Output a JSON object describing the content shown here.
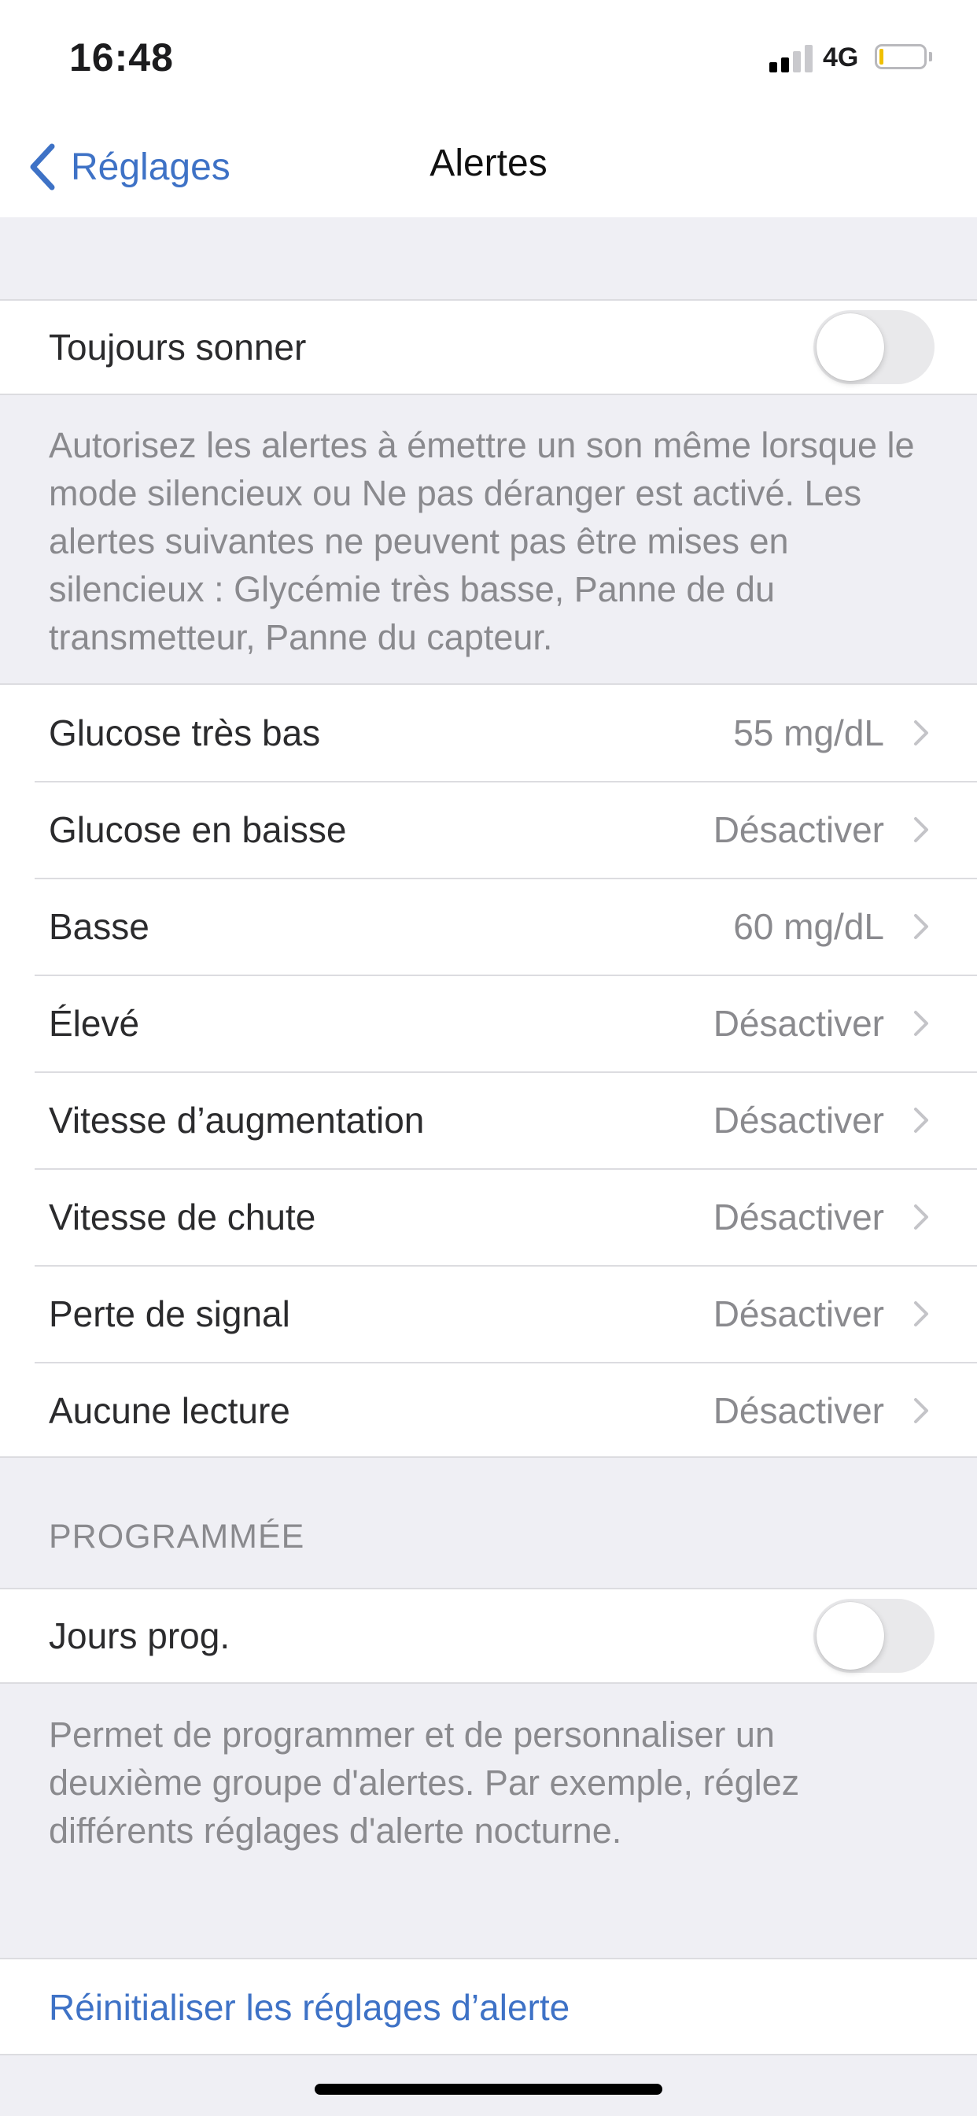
{
  "status_bar": {
    "time": "16:48",
    "network": "4G",
    "signal_bars": 2,
    "signal_bars_total": 4
  },
  "nav": {
    "back_label": "Réglages",
    "title": "Alertes"
  },
  "always_sound": {
    "label": "Toujours sonner",
    "enabled": false,
    "description": "Autorisez les alertes à émettre un son même lorsque le mode silencieux ou Ne pas déranger est activé. Les alertes suivantes ne peuvent pas être mises en silencieux : Glycémie très basse, Panne de du transmetteur, Panne du capteur."
  },
  "alerts": [
    {
      "label": "Glucose très bas",
      "value": "55 mg/dL"
    },
    {
      "label": "Glucose en baisse",
      "value": "Désactiver"
    },
    {
      "label": "Basse",
      "value": "60 mg/dL"
    },
    {
      "label": "Élevé",
      "value": "Désactiver"
    },
    {
      "label": "Vitesse d’augmentation",
      "value": "Désactiver"
    },
    {
      "label": "Vitesse de chute",
      "value": "Désactiver"
    },
    {
      "label": "Perte de signal",
      "value": "Désactiver"
    },
    {
      "label": "Aucune lecture",
      "value": "Désactiver"
    }
  ],
  "scheduled": {
    "header": "PROGRAMMÉE",
    "label": "Jours prog.",
    "enabled": false,
    "description": "Permet de programmer et de personnaliser un deuxième groupe d'alertes. Par exemple, réglez différents réglages d'alerte nocturne."
  },
  "reset": {
    "label": "Réinitialiser les réglages d’alerte"
  },
  "colors": {
    "accent": "#3e72c6",
    "grouped_background": "#efeff4",
    "secondary_text": "#8a8a8e",
    "toggle_off": "#e9e9eb"
  },
  "icons": {
    "back": "chevron-left-icon",
    "disclosure": "chevron-right-icon"
  }
}
